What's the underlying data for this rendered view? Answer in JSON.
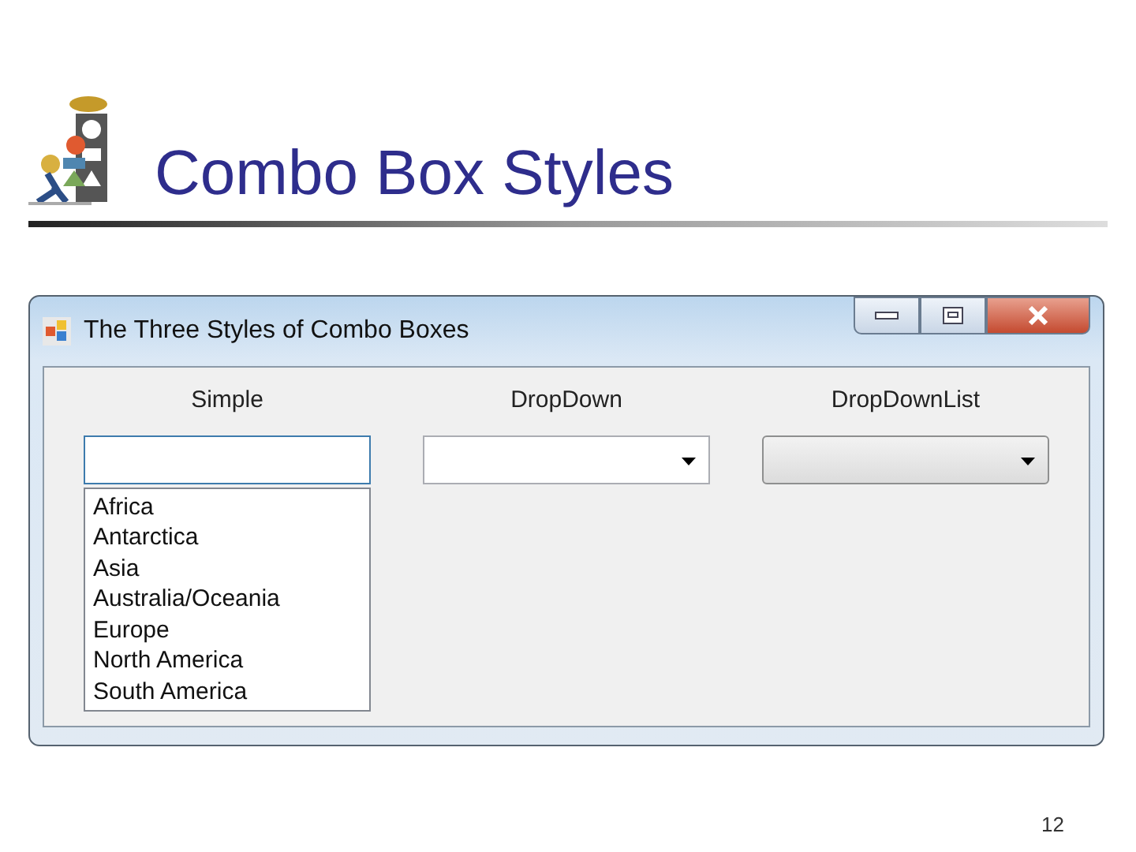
{
  "slide": {
    "title": "Combo Box Styles",
    "page_number": "12"
  },
  "window": {
    "title": "The Three Styles of Combo Boxes"
  },
  "combos": [
    {
      "kind": "simple",
      "label": "Simple",
      "items": [
        "Africa",
        "Antarctica",
        "Asia",
        "Australia/Oceania",
        "Europe",
        "North America",
        "South America"
      ]
    },
    {
      "kind": "dropdown",
      "label": "DropDown"
    },
    {
      "kind": "dropdownlist",
      "label": "DropDownList"
    }
  ]
}
